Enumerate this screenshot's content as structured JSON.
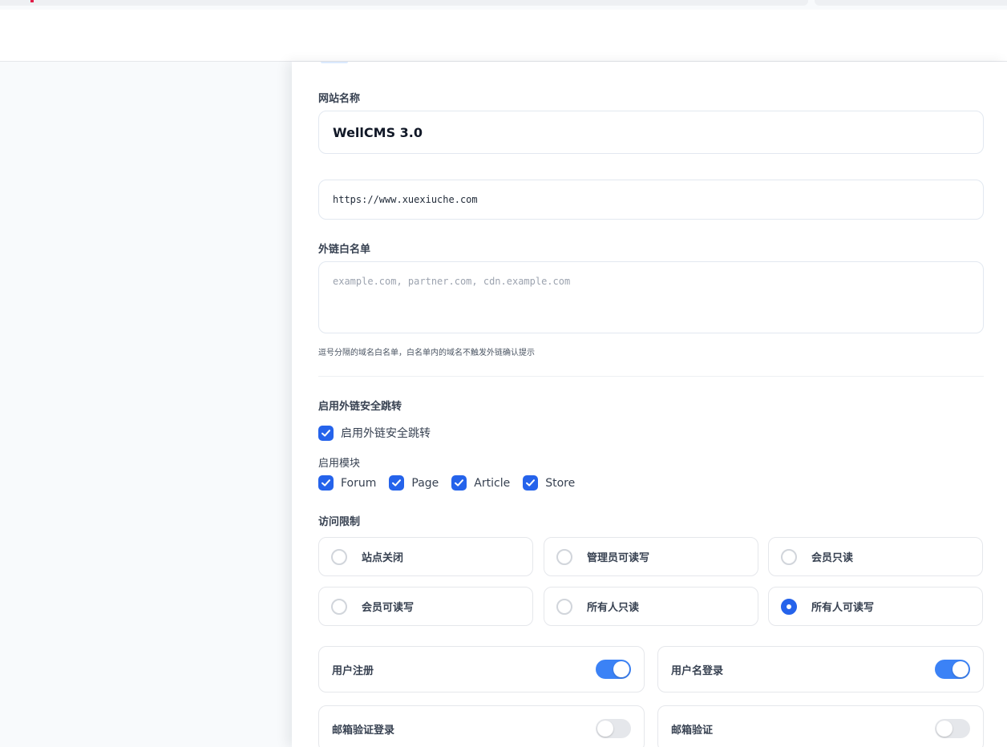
{
  "form": {
    "site_name_label": "网站名称",
    "site_name_value": "WellCMS 3.0",
    "site_url_value": "https://www.xuexiuche.com",
    "whitelist_label": "外链白名单",
    "whitelist_placeholder": "example.com, partner.com, cdn.example.com",
    "whitelist_hint": "逗号分隔的域名白名单，白名单内的域名不触发外链确认提示",
    "safe_jump_label": "启用外链安全跳转",
    "safe_jump_checkbox": {
      "label": "启用外链安全跳转",
      "checked": true
    },
    "modules_label": "启用模块",
    "modules": [
      {
        "label": "Forum",
        "checked": true
      },
      {
        "label": "Page",
        "checked": true
      },
      {
        "label": "Article",
        "checked": true
      },
      {
        "label": "Store",
        "checked": true
      }
    ],
    "access_label": "访问限制",
    "access_options": [
      {
        "label": "站点关闭",
        "selected": false
      },
      {
        "label": "管理员可读写",
        "selected": false
      },
      {
        "label": "会员只读",
        "selected": false
      },
      {
        "label": "会员可读写",
        "selected": false
      },
      {
        "label": "所有人只读",
        "selected": false
      },
      {
        "label": "所有人可读写",
        "selected": true
      }
    ],
    "toggles": [
      {
        "label": "用户注册",
        "on": true
      },
      {
        "label": "用户名登录",
        "on": true
      },
      {
        "label": "邮箱验证登录",
        "on": false
      },
      {
        "label": "邮箱验证",
        "on": false
      }
    ]
  },
  "colors": {
    "accent": "#2563eb",
    "switch_on": "#3b82f6",
    "switch_off": "#e5e7eb",
    "border": "#e2e8f0"
  }
}
